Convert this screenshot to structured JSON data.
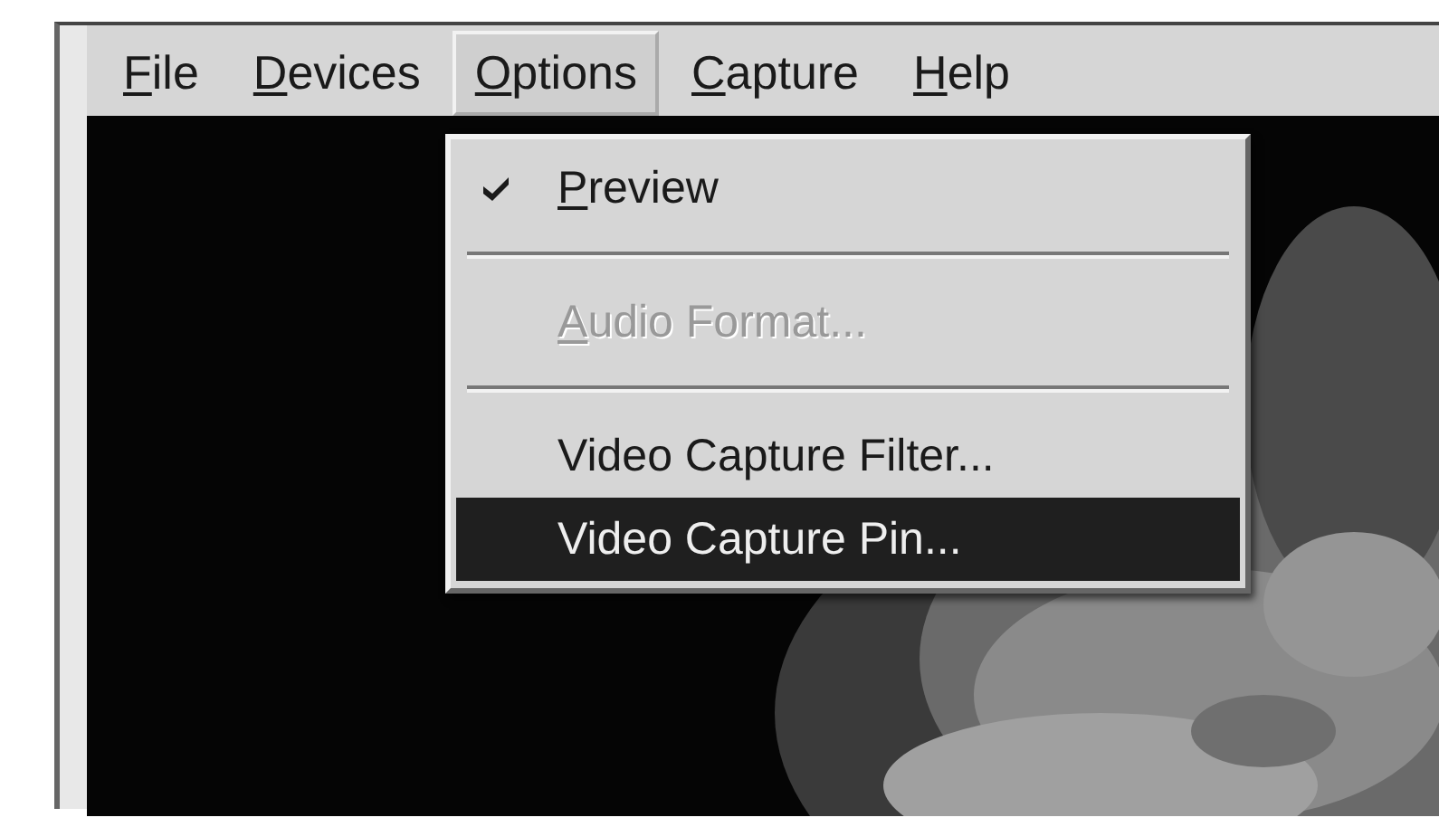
{
  "menubar": [
    {
      "label": "File",
      "mnemonic": true,
      "selected": false
    },
    {
      "label": "Devices",
      "mnemonic": true,
      "selected": false
    },
    {
      "label": "Options",
      "mnemonic": true,
      "selected": true
    },
    {
      "label": "Capture",
      "mnemonic": true,
      "selected": false
    },
    {
      "label": "Help",
      "mnemonic": true,
      "selected": false
    }
  ],
  "menu": {
    "items": [
      {
        "kind": "item",
        "label": "Preview",
        "mnemonic": true,
        "checked": true,
        "disabled": false,
        "selected": false
      },
      {
        "kind": "separator"
      },
      {
        "kind": "item",
        "label": "Audio Format...",
        "mnemonic": true,
        "checked": false,
        "disabled": true,
        "selected": false
      },
      {
        "kind": "separator"
      },
      {
        "kind": "item",
        "label": "Video Capture Filter...",
        "mnemonic": false,
        "checked": false,
        "disabled": false,
        "selected": false
      },
      {
        "kind": "item",
        "label": "Video Capture Pin...",
        "mnemonic": false,
        "checked": false,
        "disabled": false,
        "selected": true
      }
    ]
  }
}
